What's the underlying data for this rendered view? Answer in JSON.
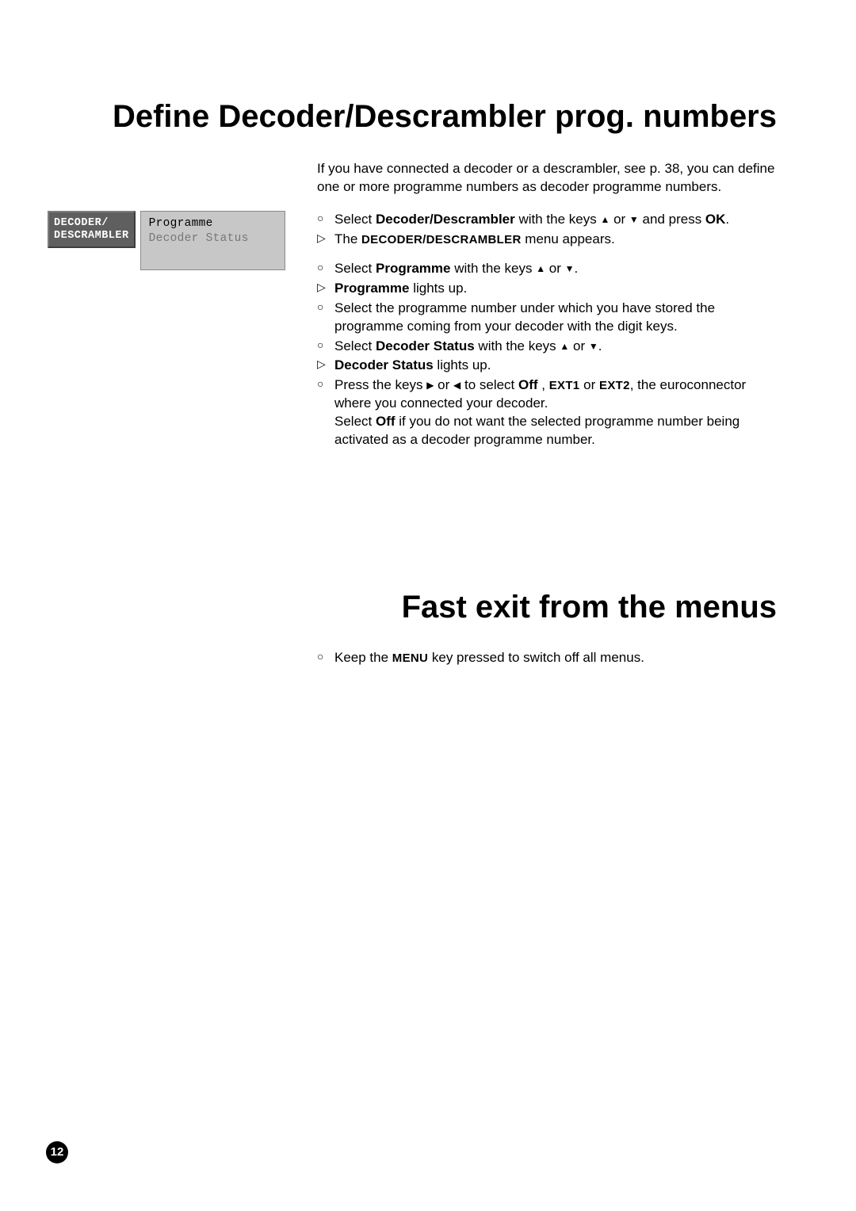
{
  "title1": "Define Decoder/Descrambler prog. numbers",
  "intro": "If you have connected a decoder or a descrambler, see p. 38, you can define one or more programme numbers as decoder programme numbers.",
  "menu": {
    "button_line1": "DECODER/",
    "button_line2": "DESCRAMBLER",
    "panel_item1": "Programme",
    "panel_item2": "Decoder Status"
  },
  "steps": {
    "s1a": "Select ",
    "s1b": "Decoder/Descrambler",
    "s1c": " with the keys ",
    "s1d": " or ",
    "s1e": " and press ",
    "s1f": "OK",
    "s1g": ".",
    "s2a": "The ",
    "s2b": "DECODER/DESCRAMBLER",
    "s2c": " menu appears.",
    "s3a": "Select ",
    "s3b": "Programme",
    "s3c": " with the keys ",
    "s3d": " or ",
    "s3e": ".",
    "s4a": "Programme",
    "s4b": " lights up.",
    "s5": "Select the programme number under which you have stored the programme coming from your decoder with the digit keys.",
    "s6a": "Select ",
    "s6b": "Decoder Status",
    "s6c": " with the keys ",
    "s6d": " or ",
    "s6e": ".",
    "s7a": "Decoder Status",
    "s7b": " lights up.",
    "s8a": "Press the keys ",
    "s8b": " or ",
    "s8c": " to select ",
    "s8d": "Off",
    "s8e": " , ",
    "s8f": "EXT1",
    "s8g": " or ",
    "s8h": "EXT2",
    "s8i": ", the euroconnector where you connected your decoder.",
    "s8cont_a": "Select ",
    "s8cont_b": "Off",
    "s8cont_c": " if you do not want the selected programme number being activated as a decoder programme number."
  },
  "title2": "Fast exit from the menus",
  "fast_a": "Keep the ",
  "fast_b": "MENU",
  "fast_c": " key pressed to switch off all menus.",
  "page_number": "12",
  "icons": {
    "up": "▲",
    "down": "▼",
    "left": "◀",
    "right": "▶"
  }
}
